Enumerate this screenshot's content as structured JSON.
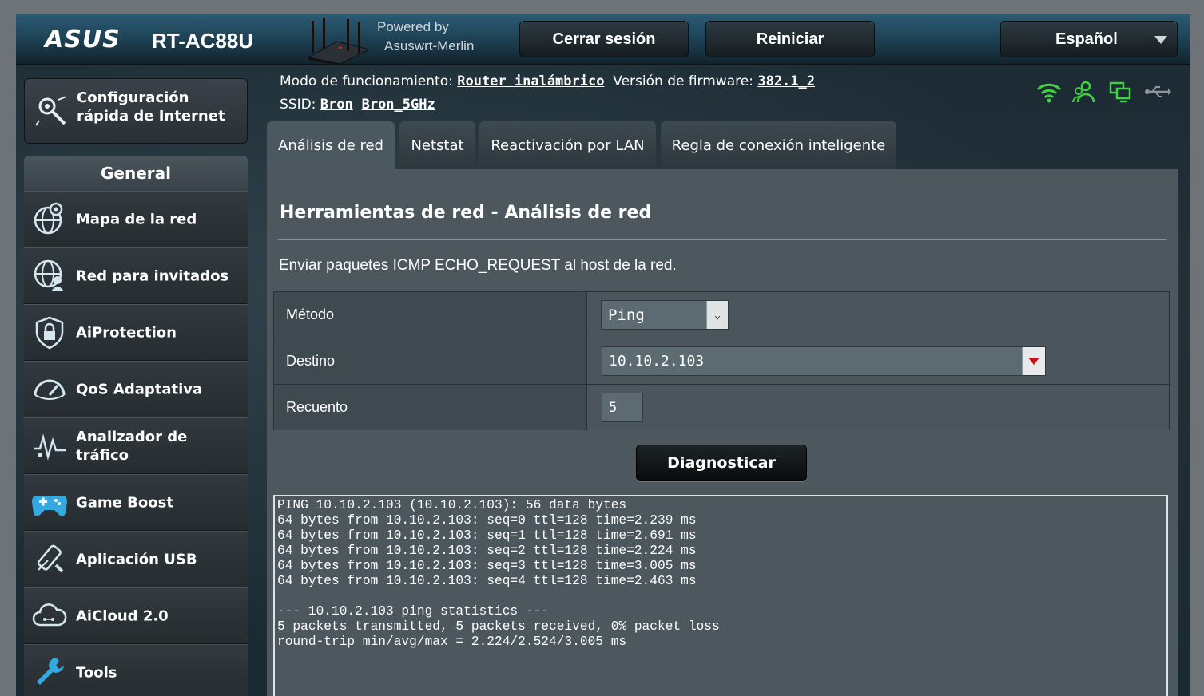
{
  "header": {
    "brand": "ASUS",
    "model": "RT-AC88U",
    "powered_by_line1": "Powered by",
    "powered_by_line2": "Asuswrt-Merlin",
    "logout_label": "Cerrar sesión",
    "reboot_label": "Reiniciar",
    "language_label": "Español"
  },
  "info": {
    "mode_label": "Modo de funcionamiento:",
    "mode_value": "Router inalámbrico",
    "firmware_label": "Versión de firmware:",
    "firmware_value": "382.1_2",
    "ssid_label": "SSID:",
    "ssid_1": "Bron",
    "ssid_2": "Bron_5GHz"
  },
  "status_icons": [
    "wifi-icon",
    "users-icon",
    "network-icon",
    "usb-icon"
  ],
  "sidebar": {
    "quick_setup_line1": "Configuración",
    "quick_setup_line2": "rápida de Internet",
    "general_header": "General",
    "items": [
      {
        "label": "Mapa de la red",
        "icon": "network-map-icon"
      },
      {
        "label": "Red para invitados",
        "icon": "guest-network-icon"
      },
      {
        "label": "AiProtection",
        "icon": "shield-lock-icon"
      },
      {
        "label": "QoS Adaptativa",
        "icon": "speedometer-icon"
      },
      {
        "label": "Analizador de tráfico",
        "icon": "traffic-analyzer-icon"
      },
      {
        "label": "Game Boost",
        "icon": "gamepad-icon"
      },
      {
        "label": "Aplicación USB",
        "icon": "usb-app-icon"
      },
      {
        "label": "AiCloud 2.0",
        "icon": "cloud-icon"
      },
      {
        "label": "Tools",
        "icon": "wrench-icon"
      }
    ]
  },
  "tabs": [
    {
      "label": "Análisis de red",
      "active": true
    },
    {
      "label": "Netstat",
      "active": false
    },
    {
      "label": "Reactivación por LAN",
      "active": false
    },
    {
      "label": "Regla de conexión inteligente",
      "active": false
    }
  ],
  "main": {
    "title": "Herramientas de red - Análisis de red",
    "description": "Enviar paquetes ICMP ECHO_REQUEST al host de la red.",
    "method_label": "Método",
    "method_value": "Ping",
    "target_label": "Destino",
    "target_value": "10.10.2.103",
    "count_label": "Recuento",
    "count_value": "5",
    "diagnose_label": "Diagnosticar",
    "output": "PING 10.10.2.103 (10.10.2.103): 56 data bytes\n64 bytes from 10.10.2.103: seq=0 ttl=128 time=2.239 ms\n64 bytes from 10.10.2.103: seq=1 ttl=128 time=2.691 ms\n64 bytes from 10.10.2.103: seq=2 ttl=128 time=2.224 ms\n64 bytes from 10.10.2.103: seq=3 ttl=128 time=3.005 ms\n64 bytes from 10.10.2.103: seq=4 ttl=128 time=2.463 ms\n\n--- 10.10.2.103 ping statistics ---\n5 packets transmitted, 5 packets received, 0% packet loss\nround-trip min/avg/max = 2.224/2.524/3.005 ms"
  },
  "colors": {
    "accent_green": "#3fd43f",
    "dropdown_arrow_red": "#c0141c"
  }
}
